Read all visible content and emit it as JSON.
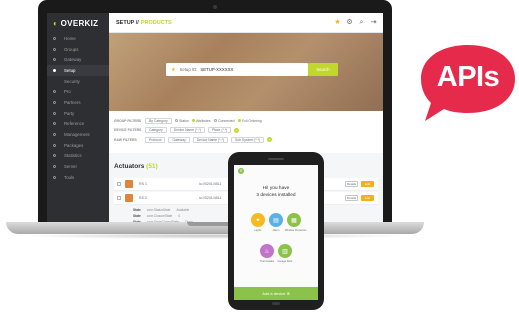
{
  "sidebar": {
    "logo": "OVERKIZ",
    "items": [
      {
        "label": "Home"
      },
      {
        "label": "Groups"
      },
      {
        "label": "Gateway"
      },
      {
        "label": "Setup",
        "active": true
      },
      {
        "label": "Security",
        "sub": true
      },
      {
        "label": "Pro"
      },
      {
        "label": "Partners"
      },
      {
        "label": "Party"
      },
      {
        "label": "Reference"
      },
      {
        "label": "Management"
      },
      {
        "label": "Packages"
      },
      {
        "label": "Statistics"
      },
      {
        "label": "Server"
      },
      {
        "label": "Tools"
      }
    ]
  },
  "topbar": {
    "crumb": "SETUP //",
    "crumb_accent": "PRODUCTS"
  },
  "search": {
    "label": "Setup ID:",
    "value": "SETUP-XXXXXX",
    "button": "Search"
  },
  "filters": [
    {
      "label": "GROUP FILTERS",
      "items": [
        "By Category",
        "Status",
        "Attributes",
        "Connected",
        "Full Ordering"
      ]
    },
    {
      "label": "DEVICE FILTERS",
      "items": [
        "Category",
        "Device Name (*.*)",
        "Place (*.*)"
      ]
    },
    {
      "label": "RAW FILTERS",
      "items": [
        "Protocol",
        "Gateway",
        "Device Name (*.*)",
        "Sub System (*.*)"
      ]
    }
  ],
  "actuators": {
    "title": "Actuators",
    "count": "(51)",
    "rows": [
      {
        "name": "RS 1",
        "id": "io://0201/4511",
        "btn_a": "Details",
        "btn_b": "Edit"
      },
      {
        "name": "RS 2",
        "id": "io://0201/4511",
        "btn_a": "Details",
        "btn_b": "Edit"
      }
    ],
    "states": [
      {
        "k": "State",
        "a": "core:StatusState",
        "b": "Available"
      },
      {
        "k": "State",
        "a": "core:ClosureState",
        "b": "0"
      },
      {
        "k": "State",
        "a": "core:OpenClosedState",
        "b": "Open"
      }
    ]
  },
  "phone": {
    "title": "Hi! you have",
    "subtitle": "3 devices installed",
    "tiles": [
      {
        "label": "Lights",
        "icon": "bulb-icon",
        "color": "#f5b921"
      },
      {
        "label": "Alarm",
        "icon": "alarm-icon",
        "color": "#5bb0e6"
      },
      {
        "label": "Window Protection",
        "icon": "window-icon",
        "color": "#8bc34a"
      },
      {
        "label": "Thermostats",
        "icon": "thermostat-icon",
        "color": "#c174c9"
      },
      {
        "label": "Garage Door",
        "icon": "garage-icon",
        "color": "#8bc34a"
      }
    ],
    "add_button": "Add a device ⊕"
  },
  "badge": {
    "text": "APIs",
    "color": "#e52a4c"
  },
  "colors": {
    "accent": "#c1d72e",
    "sidebar": "#2e2f33",
    "star": "#f2b01e"
  }
}
